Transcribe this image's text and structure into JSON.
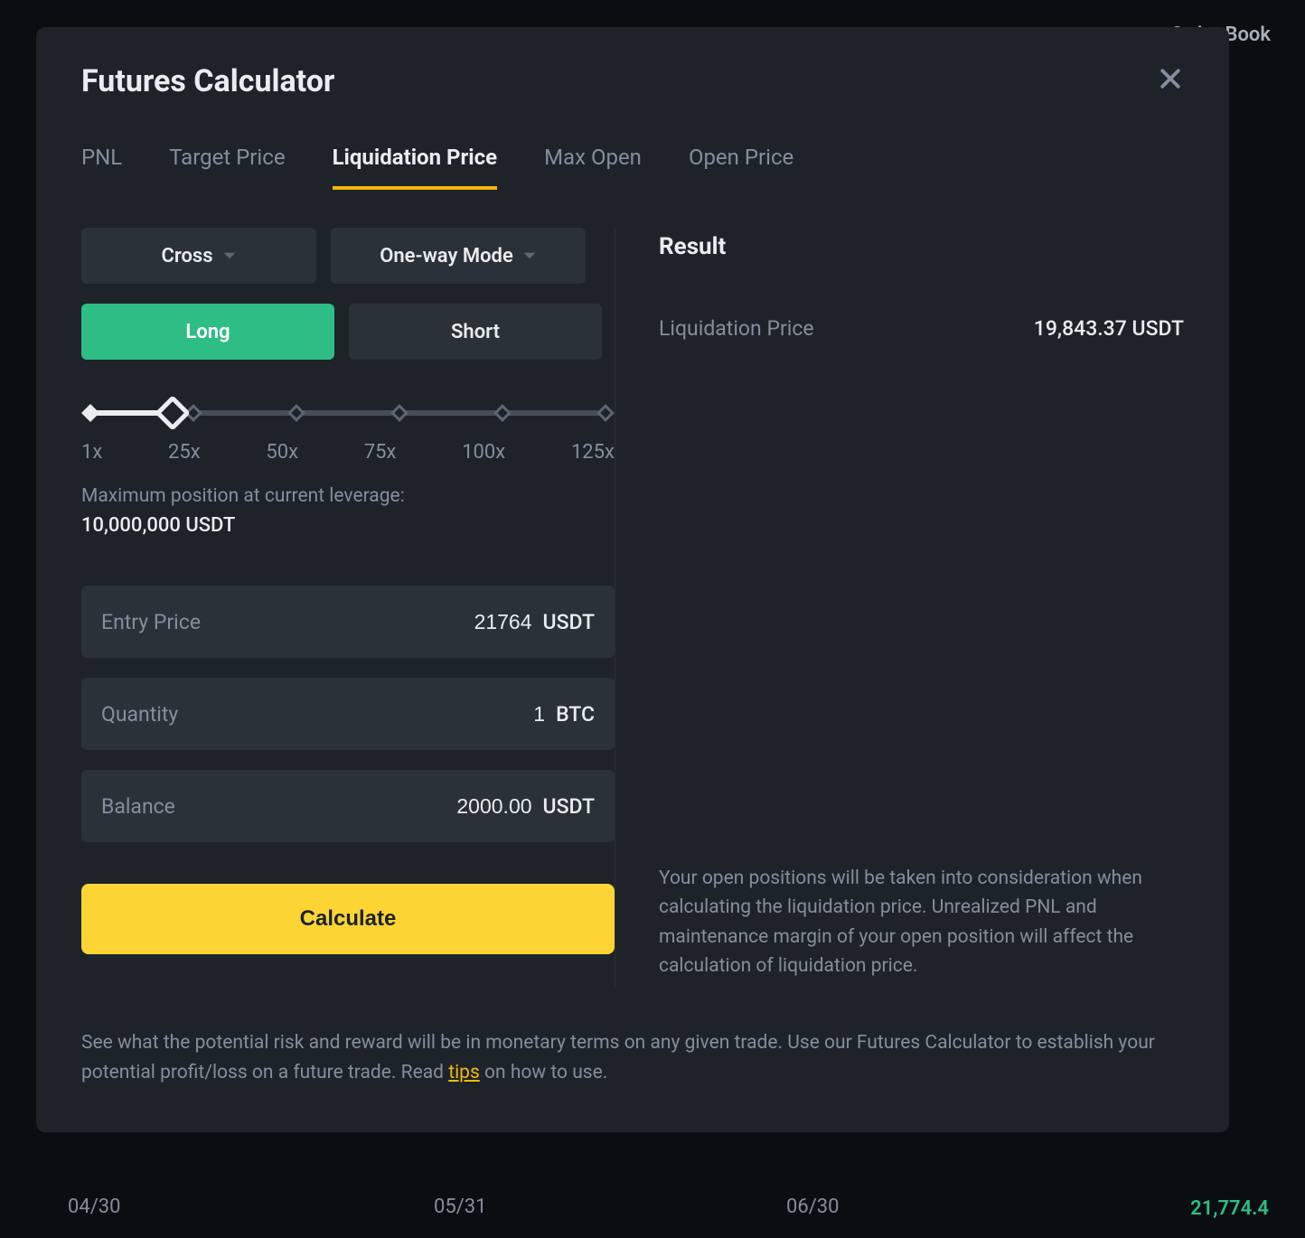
{
  "background": {
    "orderbook": "Order Book",
    "xticks": [
      "04/30",
      "05/31",
      "06/30"
    ],
    "priceRight": "21,774.4"
  },
  "header": {
    "title": "Futures Calculator"
  },
  "tabs": [
    "PNL",
    "Target Price",
    "Liquidation Price",
    "Max Open",
    "Open Price"
  ],
  "form": {
    "marginMode": "Cross",
    "positionMode": "One-way Mode",
    "sides": [
      "Long",
      "Short"
    ],
    "leverage": {
      "marks": [
        "1x",
        "25x",
        "50x",
        "75x",
        "100x",
        "125x"
      ]
    },
    "maxPosition": {
      "label": "Maximum position at current leverage:",
      "value": "10,000,000 USDT"
    },
    "entryPrice": {
      "label": "Entry Price",
      "value": "21764",
      "unit": "USDT"
    },
    "quantity": {
      "label": "Quantity",
      "value": "1",
      "unit": "BTC"
    },
    "balance": {
      "label": "Balance",
      "value": "2000.00",
      "unit": "USDT"
    },
    "calculateLabel": "Calculate"
  },
  "result": {
    "heading": "Result",
    "liquidation": {
      "label": "Liquidation Price",
      "value": "19,843.37 USDT"
    },
    "note": "Your open positions will be taken into consideration when calculating the liquidation price. Unrealized PNL and maintenance margin of your open position will affect the calculation of liquidation price."
  },
  "footer": {
    "pre": "See what the potential risk and reward will be in monetary terms on any given trade. Use our Futures Calculator to establish your potential profit/loss on a future trade. Read ",
    "linkText": "tips",
    "post": " on how to use."
  }
}
